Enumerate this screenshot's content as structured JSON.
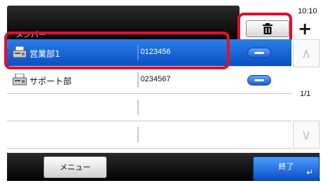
{
  "header": {
    "title": "メンバー",
    "clock": "10:10"
  },
  "toolbar": {
    "delete_icon": "trash-icon",
    "add_label": "+"
  },
  "list": {
    "rows": [
      {
        "name": "営業部1",
        "number": "0123456",
        "icon": "fax-machine-icon",
        "selected": true
      },
      {
        "name": "サポート部",
        "number": "0234567",
        "icon": "fax-machine-icon",
        "selected": false
      },
      {
        "name": "",
        "number": ""
      },
      {
        "name": "",
        "number": ""
      }
    ]
  },
  "scroll": {
    "page": "1/1"
  },
  "footer": {
    "menu_label": "メニュー",
    "end_label": "終了",
    "enter_icon": "enter-icon"
  },
  "colors": {
    "selected_row": "#0a4fc4",
    "highlight_ring": "#e0112a",
    "header_bg": "#000000"
  }
}
